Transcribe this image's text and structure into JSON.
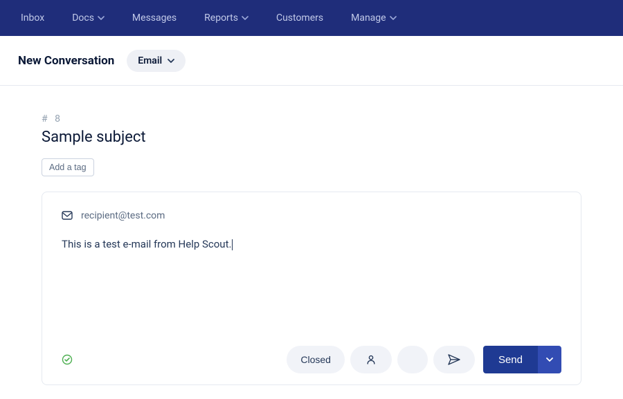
{
  "nav": {
    "items": [
      {
        "label": "Inbox",
        "hasDropdown": false
      },
      {
        "label": "Docs",
        "hasDropdown": true
      },
      {
        "label": "Messages",
        "hasDropdown": false
      },
      {
        "label": "Reports",
        "hasDropdown": true
      },
      {
        "label": "Customers",
        "hasDropdown": false
      },
      {
        "label": "Manage",
        "hasDropdown": true
      }
    ]
  },
  "toolbar": {
    "title": "New Conversation",
    "channel": "Email"
  },
  "conversation": {
    "numberPrefix": "#",
    "number": "8",
    "subject": "Sample subject",
    "addTagLabel": "Add a tag"
  },
  "editor": {
    "recipient": "recipient@test.com",
    "body": "This is a test e-mail from Help Scout."
  },
  "footer": {
    "closedLabel": "Closed",
    "sendLabel": "Send"
  }
}
